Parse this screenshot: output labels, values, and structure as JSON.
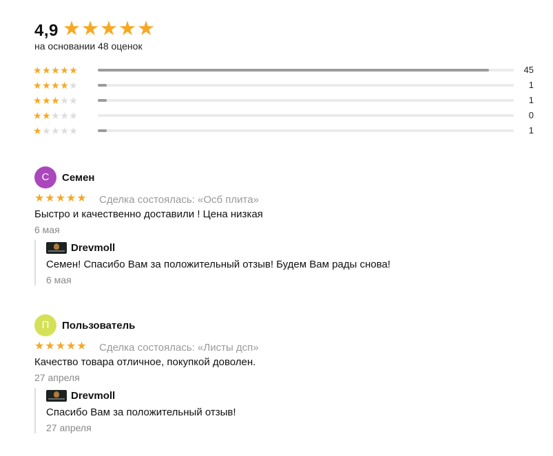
{
  "summary": {
    "average": "4,9",
    "stars_filled": 5,
    "basis_text": "на основании 48 оценок"
  },
  "distribution": [
    {
      "stars": 5,
      "count": "45",
      "fraction": 0.94
    },
    {
      "stars": 4,
      "count": "1",
      "fraction": 0.021
    },
    {
      "stars": 3,
      "count": "1",
      "fraction": 0.021
    },
    {
      "stars": 2,
      "count": "0",
      "fraction": 0
    },
    {
      "stars": 1,
      "count": "1",
      "fraction": 0.021
    }
  ],
  "reviews": [
    {
      "avatar_letter": "С",
      "avatar_color": "#ab47bc",
      "author": "Семен",
      "rating": 5,
      "deal": "Сделка состоялась: «Осб плита»",
      "text": "Быстро и качественно доставили ! Цена низкая",
      "date": "6 мая",
      "reply": {
        "author": "Drevmoll",
        "text": "Семен! Спасибо Вам за положительный отзыв! Будем Вам рады снова!",
        "date": "6 мая"
      }
    },
    {
      "avatar_letter": "П",
      "avatar_color": "#d4e157",
      "author": "Пользователь",
      "rating": 5,
      "deal": "Сделка состоялась: «Листы дсп»",
      "text": "Качество товара отличное, покупкой доволен.",
      "date": "27 апреля",
      "reply": {
        "author": "Drevmoll",
        "text": "Спасибо Вам за положительный отзыв!",
        "date": "27 апреля"
      }
    }
  ],
  "icons": {
    "star": "star-icon",
    "reply_logo": "drevmoll-logo"
  },
  "colors": {
    "star_on": "#f7a823",
    "star_off": "#dddddd",
    "bar_fill": "#9b9b9b",
    "bar_track": "#ebebeb"
  }
}
